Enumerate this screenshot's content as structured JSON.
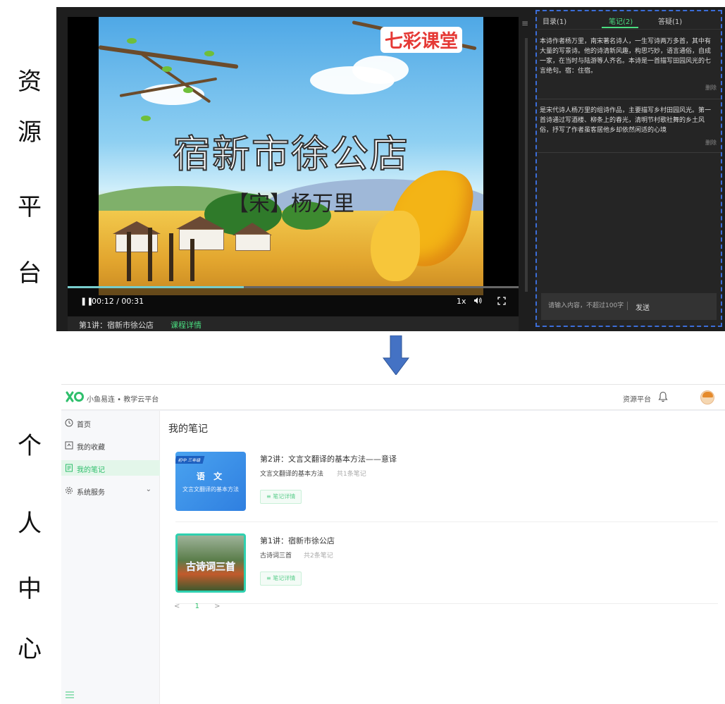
{
  "captions": {
    "top": [
      "资",
      "源",
      "平",
      "台"
    ],
    "bottom": [
      "个",
      "人",
      "中",
      "心"
    ]
  },
  "player": {
    "video_title": "宿新市徐公店",
    "video_author": "【宋】杨万里",
    "brand": "七彩课堂",
    "time": "00:12 / 00:31",
    "progress": 0.39,
    "speed": "1x",
    "lesson_label": "第1讲：宿新市徐公店",
    "detail_link": "课程详情"
  },
  "notes_panel": {
    "tabs": [
      "目录(1)",
      "笔记(2)",
      "答疑(1)"
    ],
    "active_tab": 1,
    "notes": [
      {
        "text": "本诗作者杨万里，南宋著名诗人，一生写诗两万多首，其中有大量的写景诗。他的诗清新风趣，构思巧妙，语言通俗，自成一家，在当时与陆游等人齐名。本诗是一首描写田园风光的七言绝句。宿：住宿。",
        "delete": "删除"
      },
      {
        "text": "是宋代诗人杨万里的组诗作品，主要描写乡村田园风光。第一首诗通过写酒楼、柳条上的春光，清明节村歌社舞的乡土风俗，抒写了作者虽客居他乡却依然闲适的心境",
        "delete": "删除"
      }
    ],
    "input_placeholder": "请输入内容，不超过100字",
    "send_label": "发送"
  },
  "platform": {
    "app_name": "小鱼易连 • 教学云平台",
    "resource_link": "资源平台",
    "nav": [
      {
        "label": "首页",
        "icon": "clock-icon"
      },
      {
        "label": "我的收藏",
        "icon": "collection-icon"
      },
      {
        "label": "我的笔记",
        "icon": "notes-icon",
        "active": true
      },
      {
        "label": "系统服务",
        "icon": "gear-icon",
        "expandable": true
      }
    ],
    "page_title": "我的笔记",
    "courses": [
      {
        "title": "第2讲：文言文翻译的基本方法——意译",
        "subtitle": "文言文翻译的基本方法",
        "count": "共1条笔记",
        "thumb_tag": "初中 三年级",
        "thumb_subject": "语 文",
        "thumb_topic": "文言文翻译的基本方法",
        "button": "笔记详情"
      },
      {
        "title": "第1讲：宿新市徐公店",
        "subtitle": "古诗词三首",
        "count": "共2条笔记",
        "thumb_caption": "古诗词三首",
        "button": "笔记详情"
      }
    ],
    "pager": {
      "prev": "<",
      "current": "1",
      "next": ">"
    }
  },
  "colors": {
    "accent": "#2fbf6c",
    "dashed_border": "#3b6dd8",
    "arrow": "#4472c4"
  }
}
